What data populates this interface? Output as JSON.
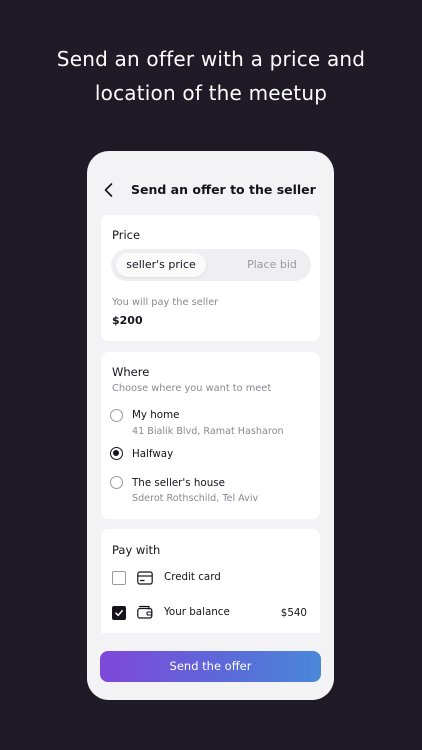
{
  "headline": {
    "line1": "Send an offer with a price and",
    "line2": "location of the meetup"
  },
  "header": {
    "title": "Send an offer to the seller"
  },
  "price": {
    "title": "Price",
    "options": [
      "seller's price",
      "Place bid"
    ],
    "selected": "seller's price",
    "pay_label": "You will pay the seller",
    "pay_value": "$200"
  },
  "where": {
    "title": "Where",
    "subtitle": "Choose where you want to meet",
    "options": [
      {
        "label": "My home",
        "sub": "41 Bialik Blvd, Ramat Hasharon",
        "selected": false
      },
      {
        "label": "Halfway",
        "sub": "",
        "selected": true
      },
      {
        "label": "The seller's house",
        "sub": "Sderot Rothschild, Tel Aviv",
        "selected": false
      }
    ]
  },
  "pay_with": {
    "title": "Pay with",
    "methods": [
      {
        "label": "Credit card",
        "icon": "credit-card-icon",
        "checked": false,
        "amount": ""
      },
      {
        "label": "Your balance",
        "icon": "wallet-icon",
        "checked": true,
        "amount": "$540"
      }
    ]
  },
  "cta": {
    "label": "Send the offer"
  },
  "colors": {
    "background": "#1e1b26",
    "surface": "#f3f3f5",
    "card": "#ffffff",
    "text": "#16131c",
    "muted": "#8a8890",
    "gradient_start": "#7f47d9",
    "gradient_end": "#4a88d9"
  }
}
